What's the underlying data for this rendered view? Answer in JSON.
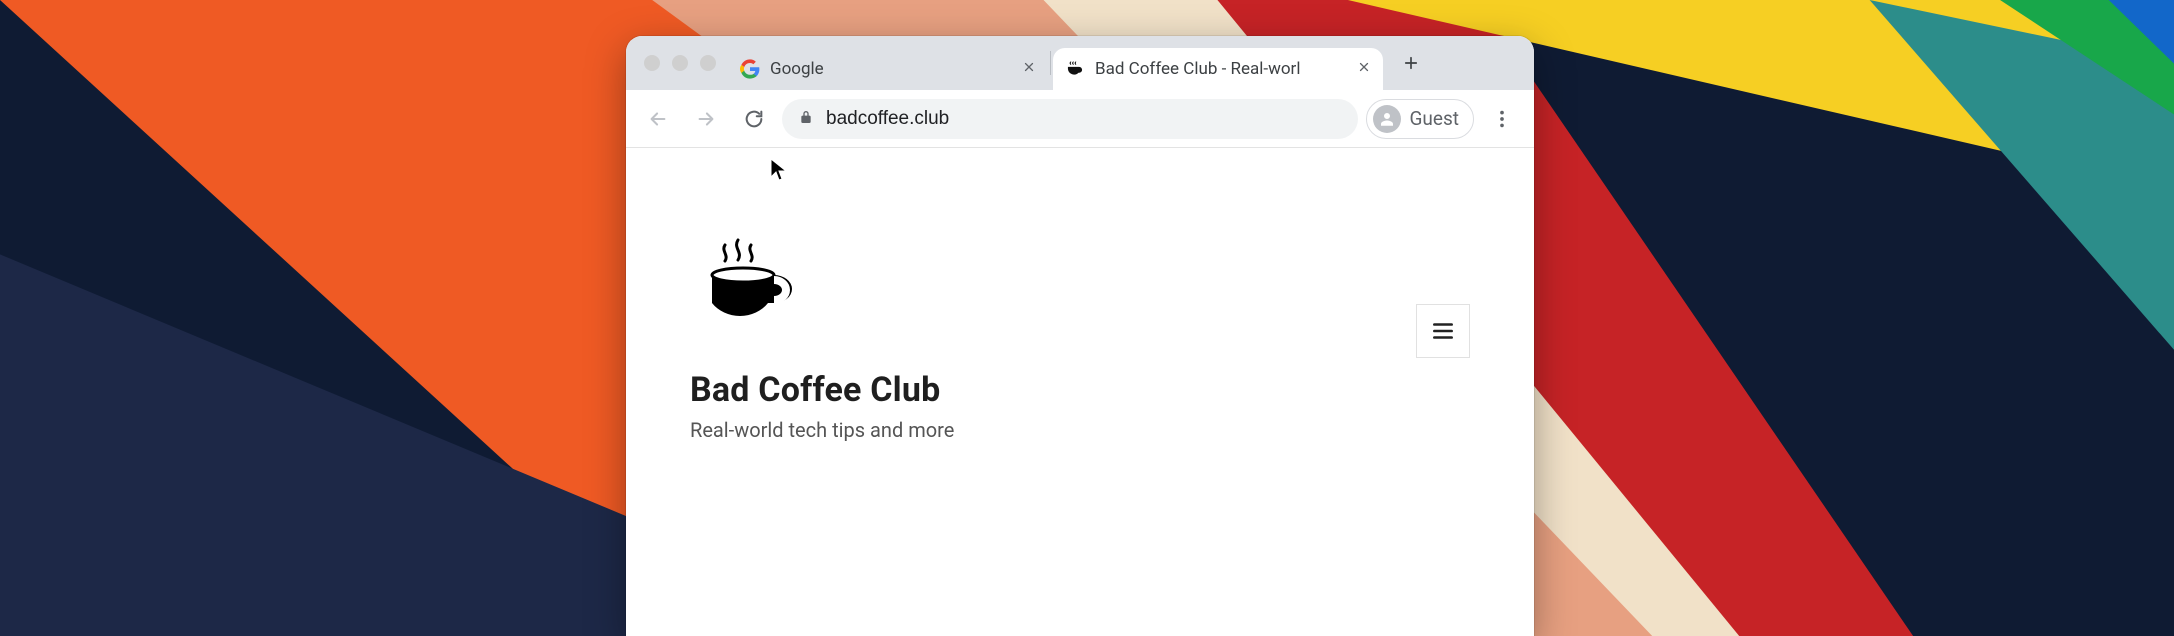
{
  "browser": {
    "tabs": [
      {
        "title": "Google"
      },
      {
        "title": "Bad Coffee Club - Real-worl"
      }
    ],
    "toolbar": {
      "url": "badcoffee.club",
      "profile_label": "Guest"
    }
  },
  "page": {
    "site_title": "Bad Coffee Club",
    "tagline": "Real-world tech tips and more"
  }
}
